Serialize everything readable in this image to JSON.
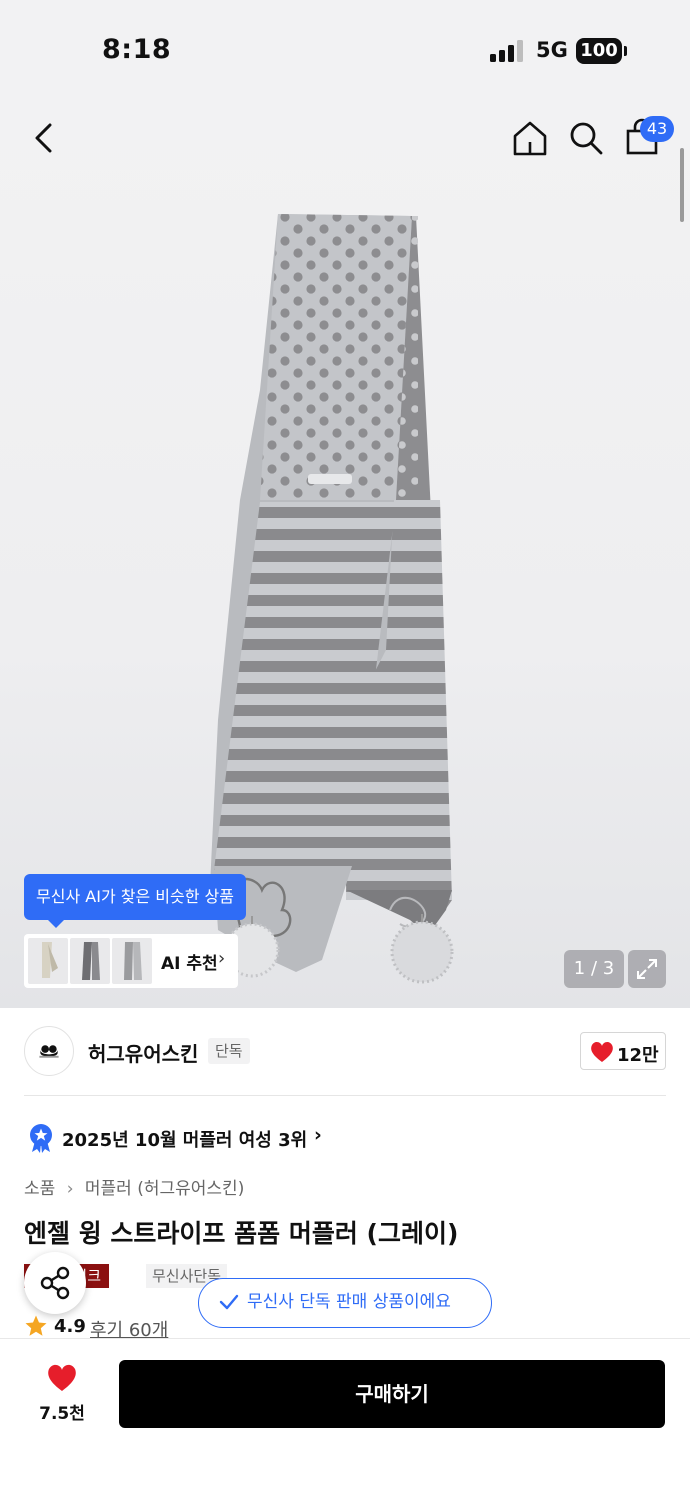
{
  "status_bar": {
    "time": "8:18",
    "network": "5G",
    "battery": "100"
  },
  "header": {
    "cart_count": "43"
  },
  "gallery": {
    "counter": "1 / 3"
  },
  "ai": {
    "tooltip": "무신사 AI가 찾은 비슷한 상품",
    "label": "AI 추천",
    "arrow": "›"
  },
  "brand": {
    "name": "허그유어스킨",
    "tag": "단독",
    "likes": "12만"
  },
  "ranking": {
    "text": "2025년 10월 머플러 여성 3위",
    "arrow": "›"
  },
  "breadcrumb": {
    "items": [
      "소품",
      "머플러 (허그유어스킨)"
    ],
    "separator": "›"
  },
  "product": {
    "title": "엔젤 윙 스트라이프 폼폼 머플러 (그레이)"
  },
  "tags": [
    "블랙스위크",
    "무신사단독"
  ],
  "toast": {
    "text": "무신사 단독 판매 상품이에요"
  },
  "rating": {
    "value": "4.9",
    "reviews": "후기 60개"
  },
  "bottom": {
    "favorites": "7.5천",
    "buy_label": "구매하기"
  },
  "colors": {
    "accent_blue": "#2f6cf6",
    "heart_red": "#e61e2b",
    "tag_red": "#8b1010",
    "buy_black": "#000000"
  }
}
